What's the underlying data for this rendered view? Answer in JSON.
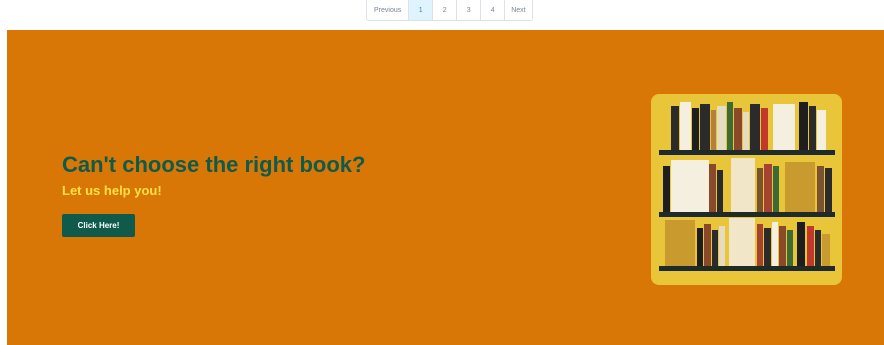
{
  "pagination": {
    "previous": "Previous",
    "pages": [
      "1",
      "2",
      "3",
      "4"
    ],
    "active_page": "1",
    "next": "Next"
  },
  "hero": {
    "background": "#d97706",
    "headline": "Can't choose the right book?",
    "subheadline": "Let us help you!",
    "cta_label": "Click Here!",
    "colors": {
      "headline": "#0f5a4b",
      "subheadline": "#fde047",
      "cta_bg": "#0f5a4b"
    }
  },
  "illustration": {
    "name": "bookshelf-illustration",
    "background": "#e9c53a"
  }
}
